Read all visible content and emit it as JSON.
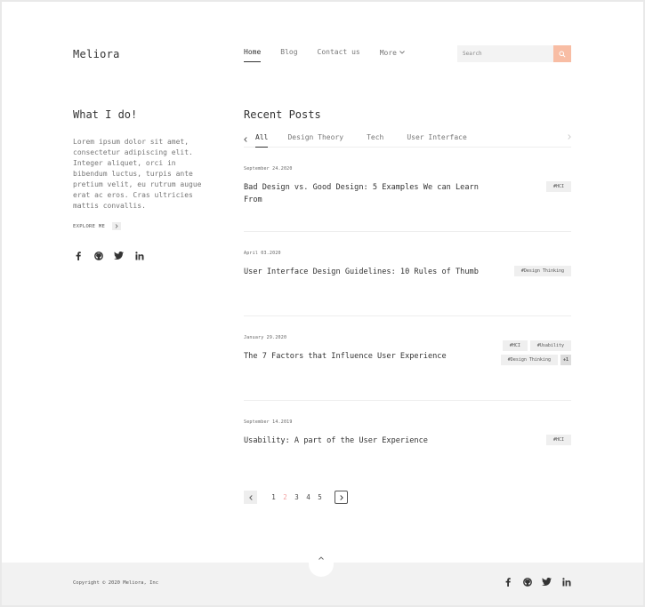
{
  "brand": {
    "logo": "Meliora"
  },
  "nav": {
    "items": [
      "Home",
      "Blog",
      "Contact us",
      "More"
    ],
    "active": "Home"
  },
  "search": {
    "placeholder": "Search",
    "value": ""
  },
  "about": {
    "title": "What I do!",
    "text": "Lorem ipsum dolor sit amet, consectetur adipiscing elit. Integer aliquet, orci in bibendum luctus, turpis ante pretium velit, eu rutrum augue erat ac eros. Cras ultricies mattis convallis.",
    "explore_label": "EXPLORE ME"
  },
  "posts": {
    "title": "Recent Posts",
    "tabs": [
      "All",
      "Design Theory",
      "Tech",
      "User Interface"
    ],
    "active_tab": "All",
    "items": [
      {
        "date": "September 24.2020",
        "title": "Bad Design vs. Good Design: 5 Examples We can Learn From",
        "tags": [
          "#HCI"
        ]
      },
      {
        "date": "April 03.2020",
        "title": "User Interface Design Guidelines: 10 Rules of Thumb",
        "tags": [
          "#Design Thinking"
        ]
      },
      {
        "date": "January 29.2020",
        "title": "The 7 Factors that Influence User Experience",
        "tags": [
          "#HCI",
          "#Usability",
          "#Design Thinking"
        ],
        "more": "+1"
      },
      {
        "date": "September 14.2019",
        "title": "Usability: A part of the User Experience",
        "tags": [
          "#HCI"
        ]
      }
    ]
  },
  "pagination": {
    "pages": [
      "1",
      "2",
      "3",
      "4",
      "5"
    ],
    "current": "2"
  },
  "footer": {
    "copyright": "Copyright © 2020 Meliora, Inc"
  },
  "social_icons": [
    "facebook-icon",
    "github-icon",
    "twitter-icon",
    "linkedin-icon"
  ],
  "colors": {
    "accent": "#f8bda4",
    "active_page": "#f2a0a0",
    "footer_bg": "#f2f2f2"
  }
}
